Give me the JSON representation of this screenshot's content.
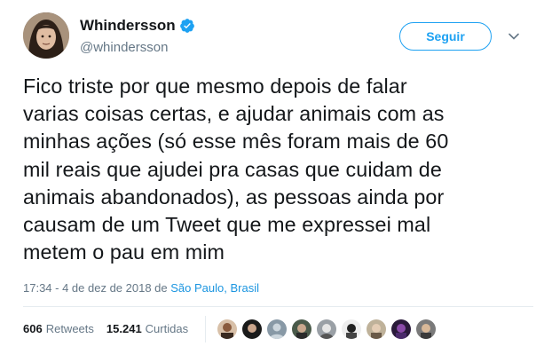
{
  "tweet": {
    "display_name": "Whindersson",
    "handle": "@whindersson",
    "follow_label": "Seguir",
    "text_lines": [
      "Fico triste por que mesmo depois de falar",
      "varias coisas certas, e ajudar animais com as",
      "minhas ações (só esse mês foram mais de 60",
      "mil reais que ajudei pra casas que cuidam de",
      "animais abandonados), as pessoas ainda por",
      "causam de um Tweet que me expressei mal",
      "metem o pau em mim"
    ],
    "timestamp": "17:34 - 4 de dez de 2018 de",
    "location": "São Paulo, Brasil",
    "retweets_count": "606",
    "retweets_label": "Retweets",
    "likes_count": "15.241",
    "likes_label": "Curtidas",
    "likers": [
      "liker-1",
      "liker-2",
      "liker-3",
      "liker-4",
      "liker-5",
      "liker-6",
      "liker-7",
      "liker-8",
      "liker-9"
    ]
  },
  "colors": {
    "accent": "#1da1f2",
    "muted": "#657786",
    "text": "#14171a"
  },
  "icons": {
    "verified": "verified-badge-icon",
    "menu": "chevron-down-icon"
  }
}
